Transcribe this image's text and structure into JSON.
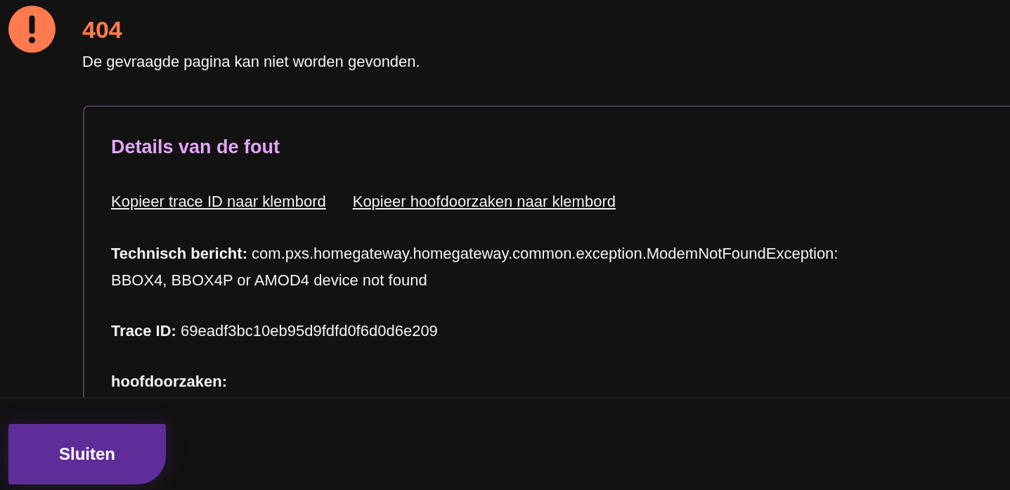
{
  "error": {
    "code": "404",
    "message": "De gevraagde pagina kan niet worden gevonden."
  },
  "details": {
    "title": "Details van de fout",
    "links": [
      "Kopieer trace ID naar klembord",
      "Kopieer hoofdoorzaken naar klembord"
    ],
    "fields": [
      "**Technisch bericht:** com.pxs.homegateway.homegateway.common.exception.ModemNotFoundException: BBOX4, BBOX4P or AMOD4 device not found",
      "**Trace ID:** 69eadf3bc10eb95d9fdfd0f6d0d6e209",
      "**hoofdoorzaken:**"
    ]
  },
  "footer": {
    "button": "Sluiten"
  }
}
